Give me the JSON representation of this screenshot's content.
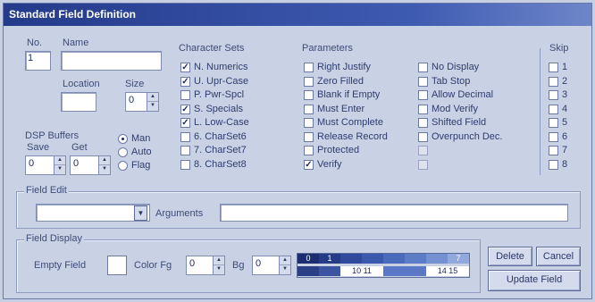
{
  "window": {
    "title": "Standard Field Definition"
  },
  "field_info": {
    "no_label": "No.",
    "no_value": "1",
    "name_label": "Name",
    "name_value": "",
    "location_label": "Location",
    "location_value": "",
    "size_label": "Size",
    "size_value": "0"
  },
  "dsp_buffers": {
    "label": "DSP Buffers",
    "save_label": "Save",
    "get_label": "Get",
    "save_value": "0",
    "get_value": "0",
    "options": [
      {
        "label": "Man",
        "selected": true
      },
      {
        "label": "Auto",
        "selected": false
      },
      {
        "label": "Flag",
        "selected": false
      }
    ]
  },
  "character_sets": {
    "title": "Character Sets",
    "items": [
      {
        "label": "N. Numerics",
        "checked": true
      },
      {
        "label": "U. Upr-Case",
        "checked": true
      },
      {
        "label": "P. Pwr-Spcl",
        "checked": false
      },
      {
        "label": "S. Specials",
        "checked": true
      },
      {
        "label": "L. Low-Case",
        "checked": true
      },
      {
        "label": "6. CharSet6",
        "checked": false
      },
      {
        "label": "7. CharSet7",
        "checked": false
      },
      {
        "label": "8. CharSet8",
        "checked": false
      }
    ]
  },
  "parameters": {
    "title": "Parameters",
    "col1": [
      {
        "label": "Right Justify",
        "checked": false
      },
      {
        "label": "Zero Filled",
        "checked": false
      },
      {
        "label": "Blank if Empty",
        "checked": false
      },
      {
        "label": "Must Enter",
        "checked": false
      },
      {
        "label": "Must Complete",
        "checked": false
      },
      {
        "label": "Release Record",
        "checked": false
      },
      {
        "label": "Protected",
        "checked": false
      },
      {
        "label": "Verify",
        "checked": true
      }
    ],
    "col2": [
      {
        "label": "No Display",
        "checked": false,
        "disabled": false
      },
      {
        "label": "Tab Stop",
        "checked": false,
        "disabled": false
      },
      {
        "label": "Allow Decimal",
        "checked": false,
        "disabled": false
      },
      {
        "label": "Mod Verify",
        "checked": false,
        "disabled": false
      },
      {
        "label": "Shifted Field",
        "checked": false,
        "disabled": false
      },
      {
        "label": "Overpunch Dec.",
        "checked": false,
        "disabled": false
      },
      {
        "label": "",
        "checked": false,
        "disabled": true
      },
      {
        "label": "",
        "checked": false,
        "disabled": true
      }
    ]
  },
  "skip": {
    "title": "Skip",
    "items": [
      "1",
      "2",
      "3",
      "4",
      "5",
      "6",
      "7",
      "8"
    ]
  },
  "field_edit": {
    "title": "Field Edit",
    "select_value": "",
    "arguments_label": "Arguments",
    "arguments_value": ""
  },
  "field_display": {
    "title": "Field Display",
    "empty_field_label": "Empty Field",
    "color_fg_label": "Color Fg",
    "color_fg_value": "0",
    "bg_label": "Bg",
    "bg_value": "0",
    "palette_labels": [
      "0",
      "1",
      "7",
      "10",
      "11",
      "14",
      "15"
    ]
  },
  "buttons": {
    "delete": "Delete",
    "cancel": "Cancel",
    "update": "Update Field"
  },
  "colors": {
    "title_bar": "#243a8a",
    "dialog_bg": "#c9d2e4",
    "palette_dark": "#1e3a8a"
  }
}
